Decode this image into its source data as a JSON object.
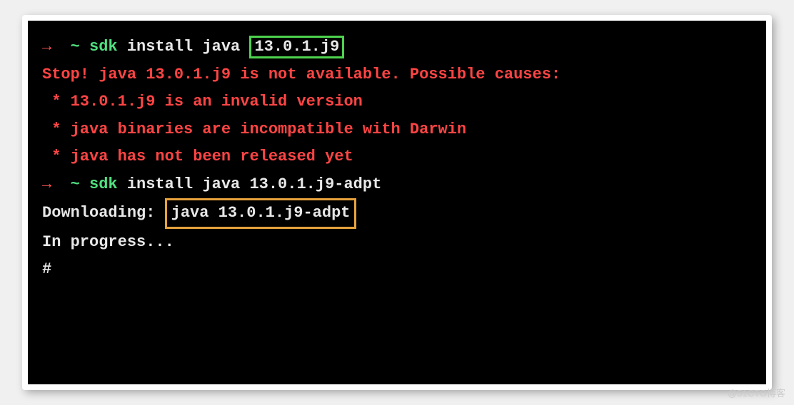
{
  "terminal": {
    "line1": {
      "arrow": "→",
      "tilde": "~",
      "sdk": "sdk",
      "cmd_before": " install java ",
      "boxed": "13.0.1.j9"
    },
    "blank1": "",
    "error1": "Stop! java 13.0.1.j9 is not available. Possible causes:",
    "error2": " * 13.0.1.j9 is an invalid version",
    "error3": " * java binaries are incompatible with Darwin",
    "error4": " * java has not been released yet",
    "line2": {
      "arrow": "→",
      "tilde": "~",
      "sdk": "sdk",
      "cmd": " install java 13.0.1.j9-adpt"
    },
    "blank2": "",
    "download_label": "Downloading: ",
    "download_boxed": "java 13.0.1.j9-adpt",
    "blank3": "",
    "progress": "In progress...",
    "blank4": "",
    "hash": "#"
  },
  "watermark": "@51CTO博客"
}
